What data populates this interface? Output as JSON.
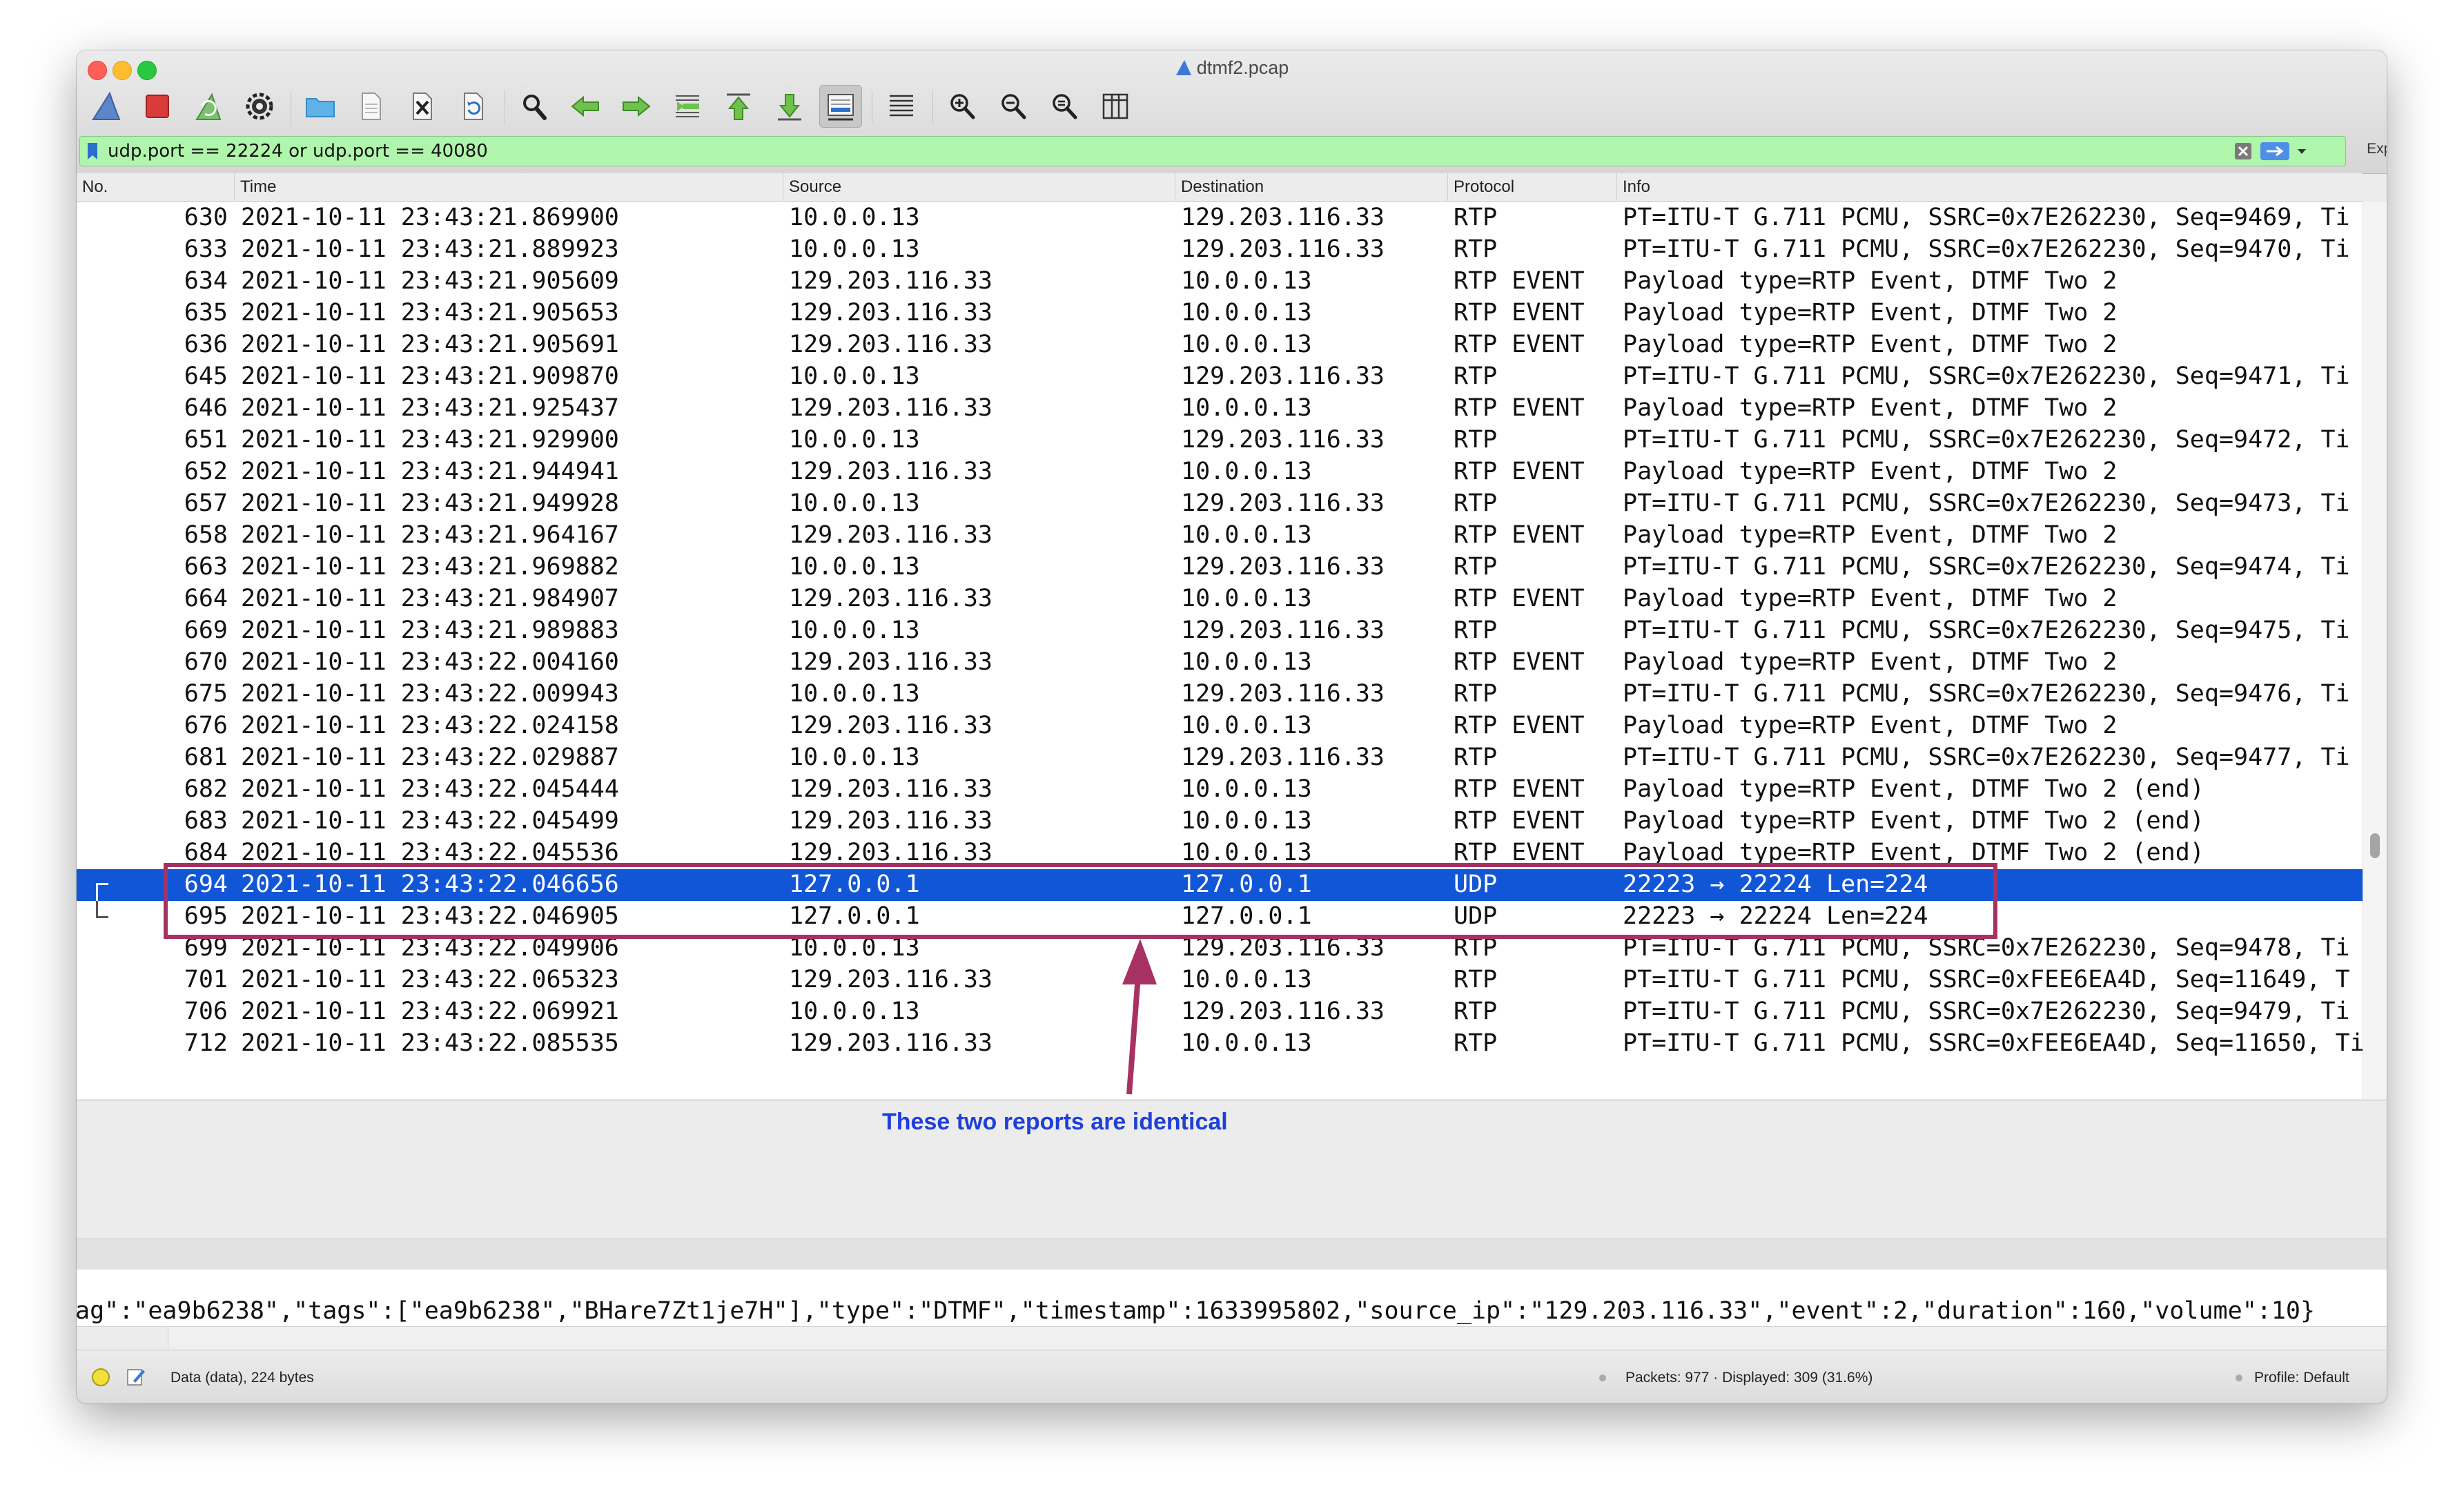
{
  "window": {
    "title": "dtmf2.pcap"
  },
  "toolbar": {
    "buttons": [
      {
        "name": "start-capture",
        "icon": "shark-fin-icon"
      },
      {
        "name": "stop-capture",
        "icon": "stop-square-icon"
      },
      {
        "name": "restart-capture",
        "icon": "restart-fin-icon"
      },
      {
        "name": "capture-options",
        "icon": "gear-icon"
      },
      {
        "name": "open-file",
        "icon": "folder-icon"
      },
      {
        "name": "save-file",
        "icon": "document-icon"
      },
      {
        "name": "close-file",
        "icon": "close-file-icon"
      },
      {
        "name": "reload-file",
        "icon": "reload-icon"
      },
      {
        "name": "find-packet",
        "icon": "search-icon"
      },
      {
        "name": "go-back",
        "icon": "arrow-left-icon"
      },
      {
        "name": "go-forward",
        "icon": "arrow-right-icon"
      },
      {
        "name": "go-to-packet",
        "icon": "jump-icon"
      },
      {
        "name": "go-first",
        "icon": "arrow-up-icon"
      },
      {
        "name": "go-last",
        "icon": "arrow-down-icon"
      },
      {
        "name": "auto-scroll",
        "icon": "autoscroll-icon"
      },
      {
        "name": "colorize",
        "icon": "colorize-lines-icon"
      },
      {
        "name": "zoom-in",
        "icon": "zoom-in-icon"
      },
      {
        "name": "zoom-out",
        "icon": "zoom-out-icon"
      },
      {
        "name": "zoom-normal",
        "icon": "zoom-normal-icon"
      },
      {
        "name": "resize-columns",
        "icon": "resize-columns-icon"
      }
    ]
  },
  "filter": {
    "value": "udp.port == 22224 or udp.port == 40080",
    "expression_label": "Expression…",
    "plus_label": "+",
    "bg_color": "#aff5ab"
  },
  "columns": [
    "No.",
    "Time",
    "Source",
    "Destination",
    "Protocol",
    "Info"
  ],
  "packets": [
    {
      "no": "630",
      "time": "2021-10-11 23:43:21.869900",
      "src": "10.0.0.13",
      "dst": "129.203.116.33",
      "proto": "RTP",
      "info": "PT=ITU-T G.711 PCMU, SSRC=0x7E262230, Seq=9469, Ti"
    },
    {
      "no": "633",
      "time": "2021-10-11 23:43:21.889923",
      "src": "10.0.0.13",
      "dst": "129.203.116.33",
      "proto": "RTP",
      "info": "PT=ITU-T G.711 PCMU, SSRC=0x7E262230, Seq=9470, Ti"
    },
    {
      "no": "634",
      "time": "2021-10-11 23:43:21.905609",
      "src": "129.203.116.33",
      "dst": "10.0.0.13",
      "proto": "RTP EVENT",
      "info": "Payload type=RTP Event, DTMF Two 2"
    },
    {
      "no": "635",
      "time": "2021-10-11 23:43:21.905653",
      "src": "129.203.116.33",
      "dst": "10.0.0.13",
      "proto": "RTP EVENT",
      "info": "Payload type=RTP Event, DTMF Two 2"
    },
    {
      "no": "636",
      "time": "2021-10-11 23:43:21.905691",
      "src": "129.203.116.33",
      "dst": "10.0.0.13",
      "proto": "RTP EVENT",
      "info": "Payload type=RTP Event, DTMF Two 2"
    },
    {
      "no": "645",
      "time": "2021-10-11 23:43:21.909870",
      "src": "10.0.0.13",
      "dst": "129.203.116.33",
      "proto": "RTP",
      "info": "PT=ITU-T G.711 PCMU, SSRC=0x7E262230, Seq=9471, Ti"
    },
    {
      "no": "646",
      "time": "2021-10-11 23:43:21.925437",
      "src": "129.203.116.33",
      "dst": "10.0.0.13",
      "proto": "RTP EVENT",
      "info": "Payload type=RTP Event, DTMF Two 2"
    },
    {
      "no": "651",
      "time": "2021-10-11 23:43:21.929900",
      "src": "10.0.0.13",
      "dst": "129.203.116.33",
      "proto": "RTP",
      "info": "PT=ITU-T G.711 PCMU, SSRC=0x7E262230, Seq=9472, Ti"
    },
    {
      "no": "652",
      "time": "2021-10-11 23:43:21.944941",
      "src": "129.203.116.33",
      "dst": "10.0.0.13",
      "proto": "RTP EVENT",
      "info": "Payload type=RTP Event, DTMF Two 2"
    },
    {
      "no": "657",
      "time": "2021-10-11 23:43:21.949928",
      "src": "10.0.0.13",
      "dst": "129.203.116.33",
      "proto": "RTP",
      "info": "PT=ITU-T G.711 PCMU, SSRC=0x7E262230, Seq=9473, Ti"
    },
    {
      "no": "658",
      "time": "2021-10-11 23:43:21.964167",
      "src": "129.203.116.33",
      "dst": "10.0.0.13",
      "proto": "RTP EVENT",
      "info": "Payload type=RTP Event, DTMF Two 2"
    },
    {
      "no": "663",
      "time": "2021-10-11 23:43:21.969882",
      "src": "10.0.0.13",
      "dst": "129.203.116.33",
      "proto": "RTP",
      "info": "PT=ITU-T G.711 PCMU, SSRC=0x7E262230, Seq=9474, Ti"
    },
    {
      "no": "664",
      "time": "2021-10-11 23:43:21.984907",
      "src": "129.203.116.33",
      "dst": "10.0.0.13",
      "proto": "RTP EVENT",
      "info": "Payload type=RTP Event, DTMF Two 2"
    },
    {
      "no": "669",
      "time": "2021-10-11 23:43:21.989883",
      "src": "10.0.0.13",
      "dst": "129.203.116.33",
      "proto": "RTP",
      "info": "PT=ITU-T G.711 PCMU, SSRC=0x7E262230, Seq=9475, Ti"
    },
    {
      "no": "670",
      "time": "2021-10-11 23:43:22.004160",
      "src": "129.203.116.33",
      "dst": "10.0.0.13",
      "proto": "RTP EVENT",
      "info": "Payload type=RTP Event, DTMF Two 2"
    },
    {
      "no": "675",
      "time": "2021-10-11 23:43:22.009943",
      "src": "10.0.0.13",
      "dst": "129.203.116.33",
      "proto": "RTP",
      "info": "PT=ITU-T G.711 PCMU, SSRC=0x7E262230, Seq=9476, Ti"
    },
    {
      "no": "676",
      "time": "2021-10-11 23:43:22.024158",
      "src": "129.203.116.33",
      "dst": "10.0.0.13",
      "proto": "RTP EVENT",
      "info": "Payload type=RTP Event, DTMF Two 2"
    },
    {
      "no": "681",
      "time": "2021-10-11 23:43:22.029887",
      "src": "10.0.0.13",
      "dst": "129.203.116.33",
      "proto": "RTP",
      "info": "PT=ITU-T G.711 PCMU, SSRC=0x7E262230, Seq=9477, Ti"
    },
    {
      "no": "682",
      "time": "2021-10-11 23:43:22.045444",
      "src": "129.203.116.33",
      "dst": "10.0.0.13",
      "proto": "RTP EVENT",
      "info": "Payload type=RTP Event, DTMF Two 2 (end)"
    },
    {
      "no": "683",
      "time": "2021-10-11 23:43:22.045499",
      "src": "129.203.116.33",
      "dst": "10.0.0.13",
      "proto": "RTP EVENT",
      "info": "Payload type=RTP Event, DTMF Two 2 (end)"
    },
    {
      "no": "684",
      "time": "2021-10-11 23:43:22.045536",
      "src": "129.203.116.33",
      "dst": "10.0.0.13",
      "proto": "RTP EVENT",
      "info": "Payload type=RTP Event, DTMF Two 2 (end)"
    },
    {
      "no": "694",
      "time": "2021-10-11 23:43:22.046656",
      "src": "127.0.0.1",
      "dst": "127.0.0.1",
      "proto": "UDP",
      "info": "22223 → 22224 Len=224",
      "selected": true,
      "rel": "start"
    },
    {
      "no": "695",
      "time": "2021-10-11 23:43:22.046905",
      "src": "127.0.0.1",
      "dst": "127.0.0.1",
      "proto": "UDP",
      "info": "22223 → 22224 Len=224",
      "rel": "end"
    },
    {
      "no": "699",
      "time": "2021-10-11 23:43:22.049906",
      "src": "10.0.0.13",
      "dst": "129.203.116.33",
      "proto": "RTP",
      "info": "PT=ITU-T G.711 PCMU, SSRC=0x7E262230, Seq=9478, Ti"
    },
    {
      "no": "701",
      "time": "2021-10-11 23:43:22.065323",
      "src": "129.203.116.33",
      "dst": "10.0.0.13",
      "proto": "RTP",
      "info": "PT=ITU-T G.711 PCMU, SSRC=0xFEE6EA4D, Seq=11649, T"
    },
    {
      "no": "706",
      "time": "2021-10-11 23:43:22.069921",
      "src": "10.0.0.13",
      "dst": "129.203.116.33",
      "proto": "RTP",
      "info": "PT=ITU-T G.711 PCMU, SSRC=0x7E262230, Seq=9479, Ti"
    },
    {
      "no": "712",
      "time": "2021-10-11 23:43:22.085535",
      "src": "129.203.116.33",
      "dst": "10.0.0.13",
      "proto": "RTP",
      "info": "PT=ITU-T G.711 PCMU, SSRC=0xFEE6EA4D, Seq=11650, Ti"
    }
  ],
  "bytes_pane": {
    "text": "ag\":\"ea9b6238\",\"tags\":[\"ea9b6238\",\"BHare7Zt1je7H\"],\"type\":\"DTMF\",\"timestamp\":1633995802,\"source_ip\":\"129.203.116.33\",\"event\":2,\"duration\":160,\"volume\":10}"
  },
  "status": {
    "left": "Data (data), 224 bytes",
    "center": "Packets: 977 · Displayed: 309 (31.6%)",
    "right": "Profile: Default"
  },
  "annotation": {
    "text": "These two reports are identical",
    "box_color": "#a73163",
    "text_color": "#1f3fd9"
  },
  "colors": {
    "selected_row": "#1256d8"
  }
}
